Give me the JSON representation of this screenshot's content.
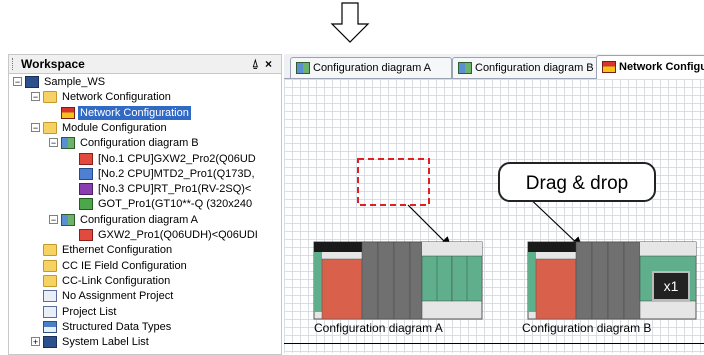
{
  "workspace": {
    "title": "Workspace",
    "pin_glyph": "⍙",
    "close_glyph": "×",
    "tree": [
      {
        "label": "Sample_WS",
        "icon": "workspace-icon",
        "level": 0,
        "expander": "−"
      },
      {
        "label": "Network Configuration",
        "icon": "folder-icon",
        "level": 1,
        "expander": "−"
      },
      {
        "label": "Network Configuration",
        "icon": "network-config-icon",
        "level": 2,
        "selected": true
      },
      {
        "label": "Module Configuration",
        "icon": "folder-icon",
        "level": 1,
        "expander": "−"
      },
      {
        "label": "Configuration diagram B",
        "icon": "config-diagram-icon",
        "level": 2,
        "expander": "−"
      },
      {
        "label": "[No.1 CPU]GXW2_Pro2(Q06UD",
        "icon": "cpu-icon",
        "level": 3
      },
      {
        "label": "[No.2 CPU]MTD2_Pro1(Q173D,",
        "icon": "motion-icon",
        "level": 3
      },
      {
        "label": "[No.3 CPU]RT_Pro1(RV-2SQ)<",
        "icon": "robot-icon",
        "level": 3
      },
      {
        "label": "GOT_Pro1(GT10**-Q (320x240",
        "icon": "got-icon",
        "level": 3
      },
      {
        "label": "Configuration diagram A",
        "icon": "config-diagram-icon",
        "level": 2,
        "expander": "−"
      },
      {
        "label": "GXW2_Pro1(Q06UDH)<Q06UDI",
        "icon": "cpu-icon",
        "level": 3
      },
      {
        "label": "Ethernet Configuration",
        "icon": "folder-icon",
        "level": 1
      },
      {
        "label": "CC IE Field Configuration",
        "icon": "folder-icon",
        "level": 1
      },
      {
        "label": "CC-Link Configuration",
        "icon": "folder-icon",
        "level": 1
      },
      {
        "label": "No Assignment Project",
        "icon": "project-icon",
        "level": 1
      },
      {
        "label": "Project List",
        "icon": "document-icon",
        "level": 1
      },
      {
        "label": "Structured Data Types",
        "icon": "struct-icon",
        "level": 1
      },
      {
        "label": "System Label List",
        "icon": "label-list-icon",
        "level": 1,
        "expander": "+"
      }
    ]
  },
  "editor": {
    "tabs": [
      {
        "label": "Configuration diagram A",
        "icon": "config-diagram-icon",
        "active": false
      },
      {
        "label": "Configuration diagram B",
        "icon": "config-diagram-icon",
        "active": false
      },
      {
        "label": "Network Configuration",
        "icon": "network-config-icon",
        "active": true
      }
    ],
    "drag_drop_label": "Drag & drop",
    "diagram_a_caption": "Configuration diagram A",
    "diagram_b_caption": "Configuration diagram B",
    "multiplier_badge": "x1"
  },
  "colors": {
    "selection": "#316ac5",
    "dashed_box": "#e02020",
    "module_red": "#d9604a",
    "module_green": "#5fae8c",
    "module_gray": "#707070"
  }
}
